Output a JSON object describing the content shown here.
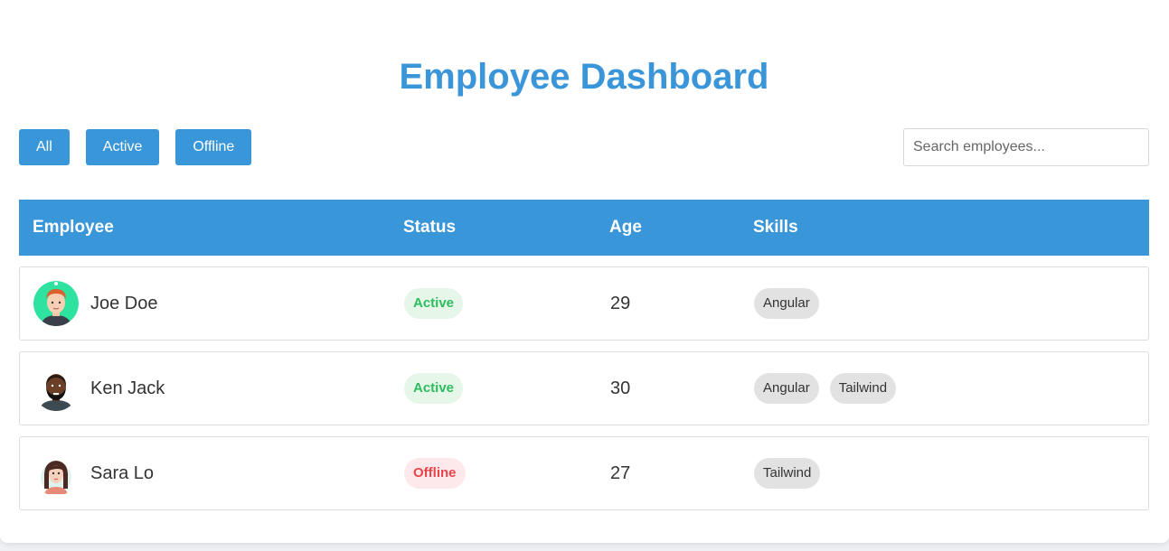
{
  "header": {
    "title": "Employee Dashboard"
  },
  "filters": {
    "all": "All",
    "active": "Active",
    "offline": "Offline"
  },
  "search": {
    "placeholder": "Search employees..."
  },
  "table": {
    "columns": {
      "employee": "Employee",
      "status": "Status",
      "age": "Age",
      "skills": "Skills"
    },
    "rows": [
      {
        "name": "Joe Doe",
        "status": "Active",
        "age": "29",
        "skills": [
          "Angular"
        ]
      },
      {
        "name": "Ken Jack",
        "status": "Active",
        "age": "30",
        "skills": [
          "Angular",
          "Tailwind"
        ]
      },
      {
        "name": "Sara Lo",
        "status": "Offline",
        "age": "27",
        "skills": [
          "Tailwind"
        ]
      }
    ]
  },
  "colors": {
    "accent": "#3896d9",
    "active": "#2dbd5f",
    "offline": "#e8454b"
  }
}
